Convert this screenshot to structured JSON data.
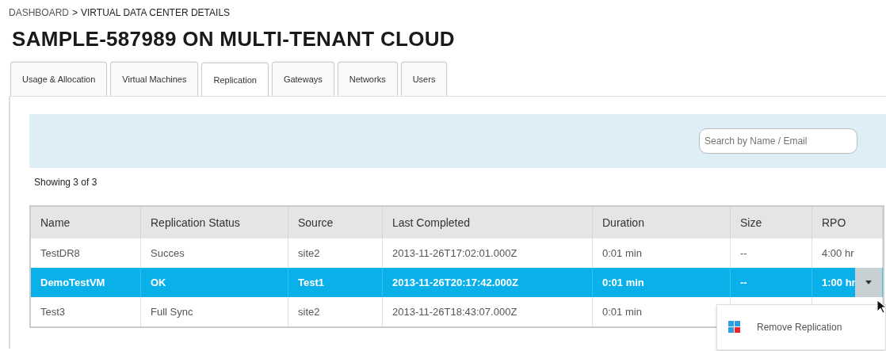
{
  "breadcrumb": [
    {
      "label": "DASHBOARD",
      "kind": "link"
    },
    {
      "label": ">",
      "kind": "separator"
    },
    {
      "label": "VIRTUAL DATA CENTER DETAILS",
      "kind": "current"
    }
  ],
  "title": "SAMPLE-587989 ON MULTI-TENANT CLOUD",
  "tabs": [
    {
      "label": "Usage & Allocation",
      "selected": false
    },
    {
      "label": "Virtual Machines",
      "selected": false
    },
    {
      "label": "Replication",
      "selected": true
    },
    {
      "label": "Gateways",
      "selected": false
    },
    {
      "label": "Networks",
      "selected": false
    },
    {
      "label": "Users",
      "selected": false
    }
  ],
  "search": {
    "placeholder": "Search by Name / Email"
  },
  "count": "Showing 3 of 3",
  "table": {
    "columns": [
      "Name",
      "Replication Status",
      "Source",
      "Last Completed",
      "Duration",
      "Size",
      "RPO"
    ],
    "rows": [
      {
        "selected": false,
        "cells": [
          "TestDR8",
          "Succes",
          "site2",
          "2013-11-26T17:02:01.000Z",
          "0:01 min",
          "--",
          "4:00 hr"
        ]
      },
      {
        "selected": true,
        "cells": [
          "DemoTestVM",
          "OK",
          "Test1",
          "2013-11-26T20:17:42.000Z",
          "0:01 min",
          "--",
          "1:00 hr"
        ],
        "menu_button": true
      },
      {
        "selected": false,
        "cells": [
          "Test3",
          "Full Sync",
          "site2",
          "2013-11-26T18:43:07.000Z",
          "0:01 min"
        ]
      }
    ]
  },
  "row_menu": {
    "items": [
      {
        "label": "Remove Replication"
      }
    ]
  }
}
